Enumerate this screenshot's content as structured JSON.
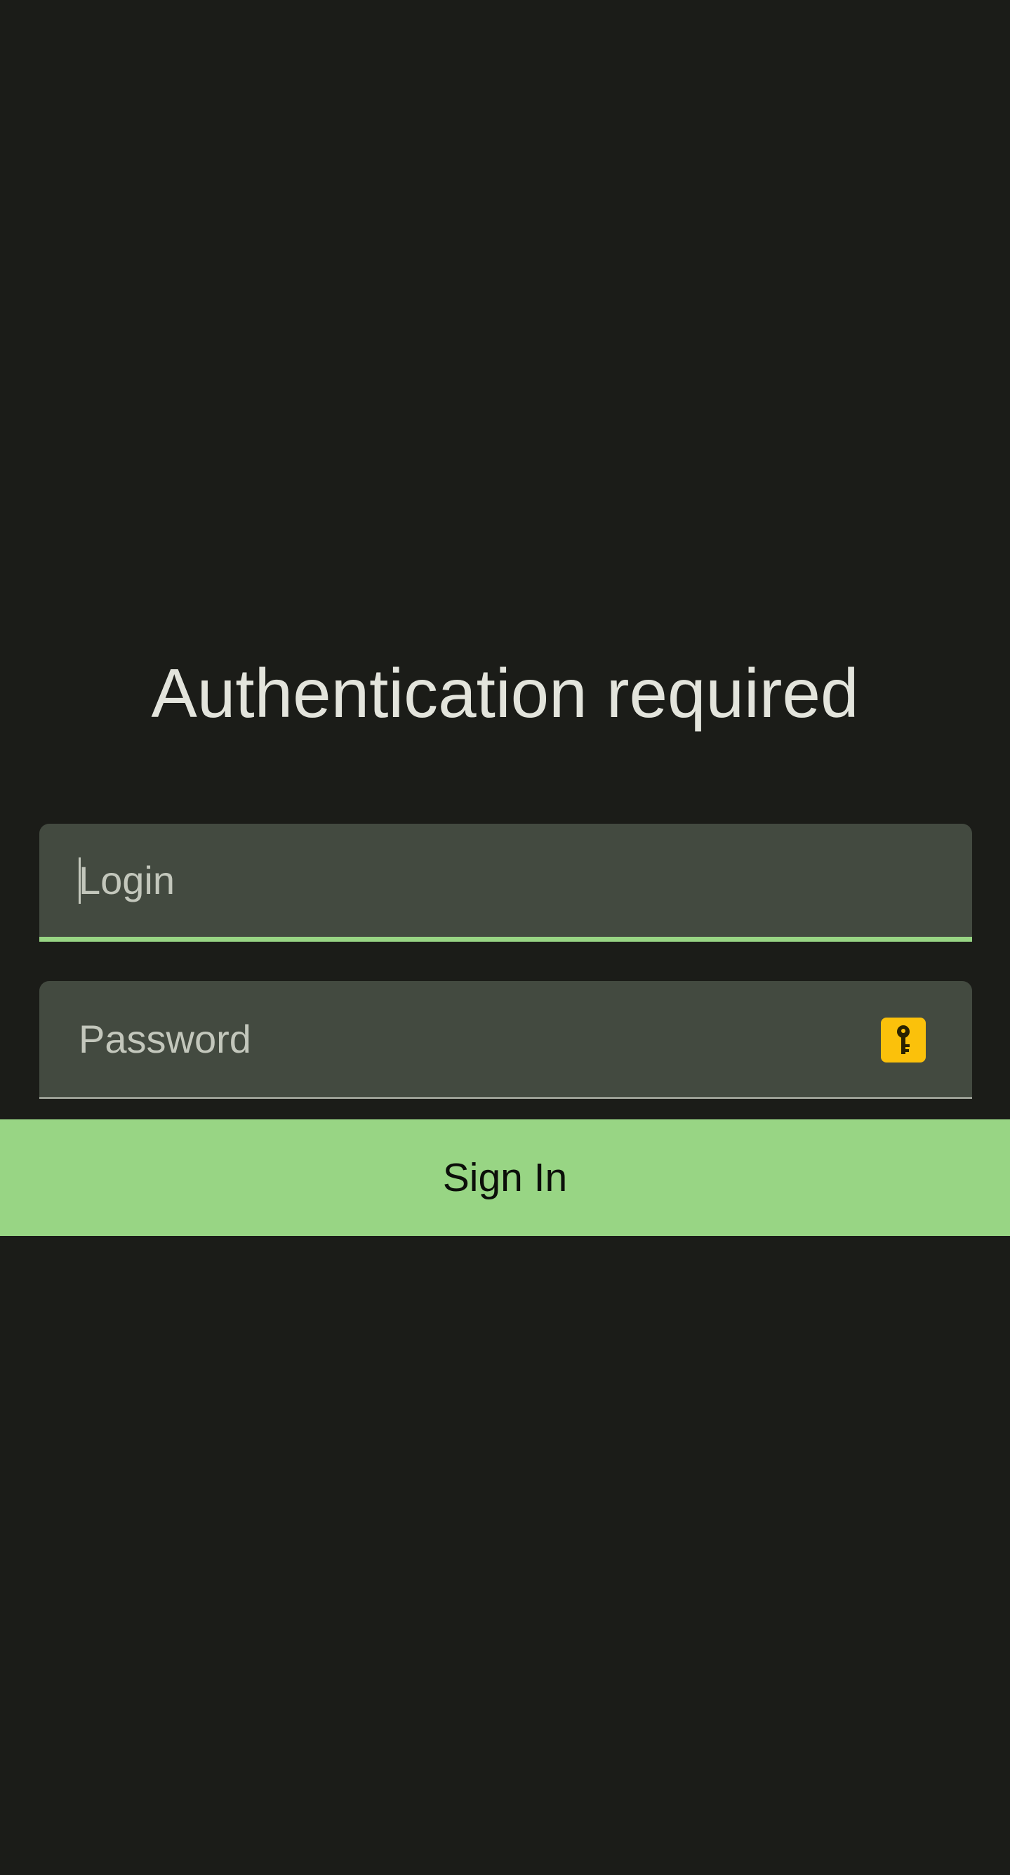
{
  "auth": {
    "title": "Authentication required",
    "login_placeholder": "Login",
    "login_value": "",
    "password_placeholder": "Password",
    "password_value": "",
    "password_manager_icon": "key-icon",
    "signin_label": "Sign In"
  },
  "colors": {
    "background": "#1b1c18",
    "field_background": "#434a40",
    "accent": "#98d584",
    "key_badge": "#fbc10b",
    "title_text": "#e3e4dc"
  }
}
